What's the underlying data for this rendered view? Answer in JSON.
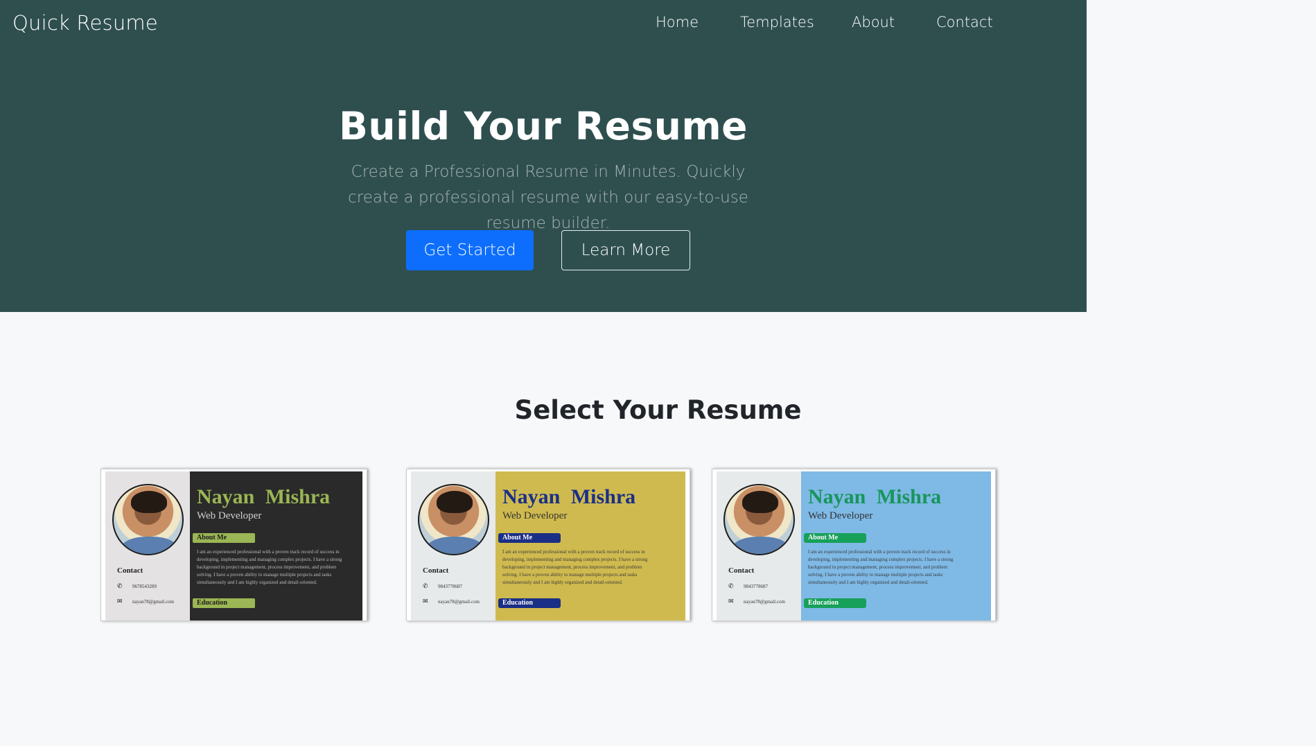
{
  "brand": "Quick Resume",
  "nav": [
    "Home",
    "Templates",
    "About",
    "Contact"
  ],
  "hero": {
    "title": "Build Your Resume",
    "subtitle": "Create a Professional Resume in Minutes. Quickly create a professional resume with our easy-to-use resume builder.",
    "primary_button": "Get Started",
    "secondary_button": "Learn More"
  },
  "templates_section": {
    "title": "Select Your Resume"
  },
  "templates": [
    {
      "name": "Nayan  Mishra",
      "role": "Web Developer",
      "about_label": "About Me",
      "about_text": "I am an experienced professional with a proven track record of success in developing, implementing and managing complex projects. I have a strong background in project management, process improvement, and problem solving. I have a proven ability to manage multiple projects and tasks simultaneously and I am highly organized and detail-oriented.",
      "education_label": "Education",
      "contact_label": "Contact",
      "phone": "9678543289",
      "email": "nayan78@gmail.com",
      "accent_color": "#9bb654",
      "background_color": "#2a2a2a"
    },
    {
      "name": "Nayan  Mishra",
      "role": "Web Developer",
      "about_label": "About Me",
      "about_text": "I am an experienced professional with a proven track record of success in developing, implementing and managing complex projects. I have a strong background in project management, process improvement, and problem solving. I have a proven ability to manage multiple projects and tasks simultaneously and I am highly organized and detail-oriented.",
      "education_label": "Education",
      "contact_label": "Contact",
      "phone": "9843778687",
      "email": "nayan78@gmail.com",
      "accent_color": "#1a2f86",
      "background_color": "#cfba4f"
    },
    {
      "name": "Nayan  Mishra",
      "role": "Web Developer",
      "about_label": "About Me",
      "about_text": "I am an experienced professional with a proven track record of success in developing, implementing and managing complex projects. I have a strong background in project management, process improvement, and problem solving. I have a proven ability to manage multiple projects and tasks simultaneously and I am highly organized and detail-oriented.",
      "education_label": "Education",
      "contact_label": "Contact",
      "phone": "9843778687",
      "email": "nayan78@gmail.com",
      "accent_color": "#17a05a",
      "background_color": "#7fb9e6"
    }
  ],
  "icons": {
    "phone": "phone-icon",
    "email": "envelope-icon"
  }
}
